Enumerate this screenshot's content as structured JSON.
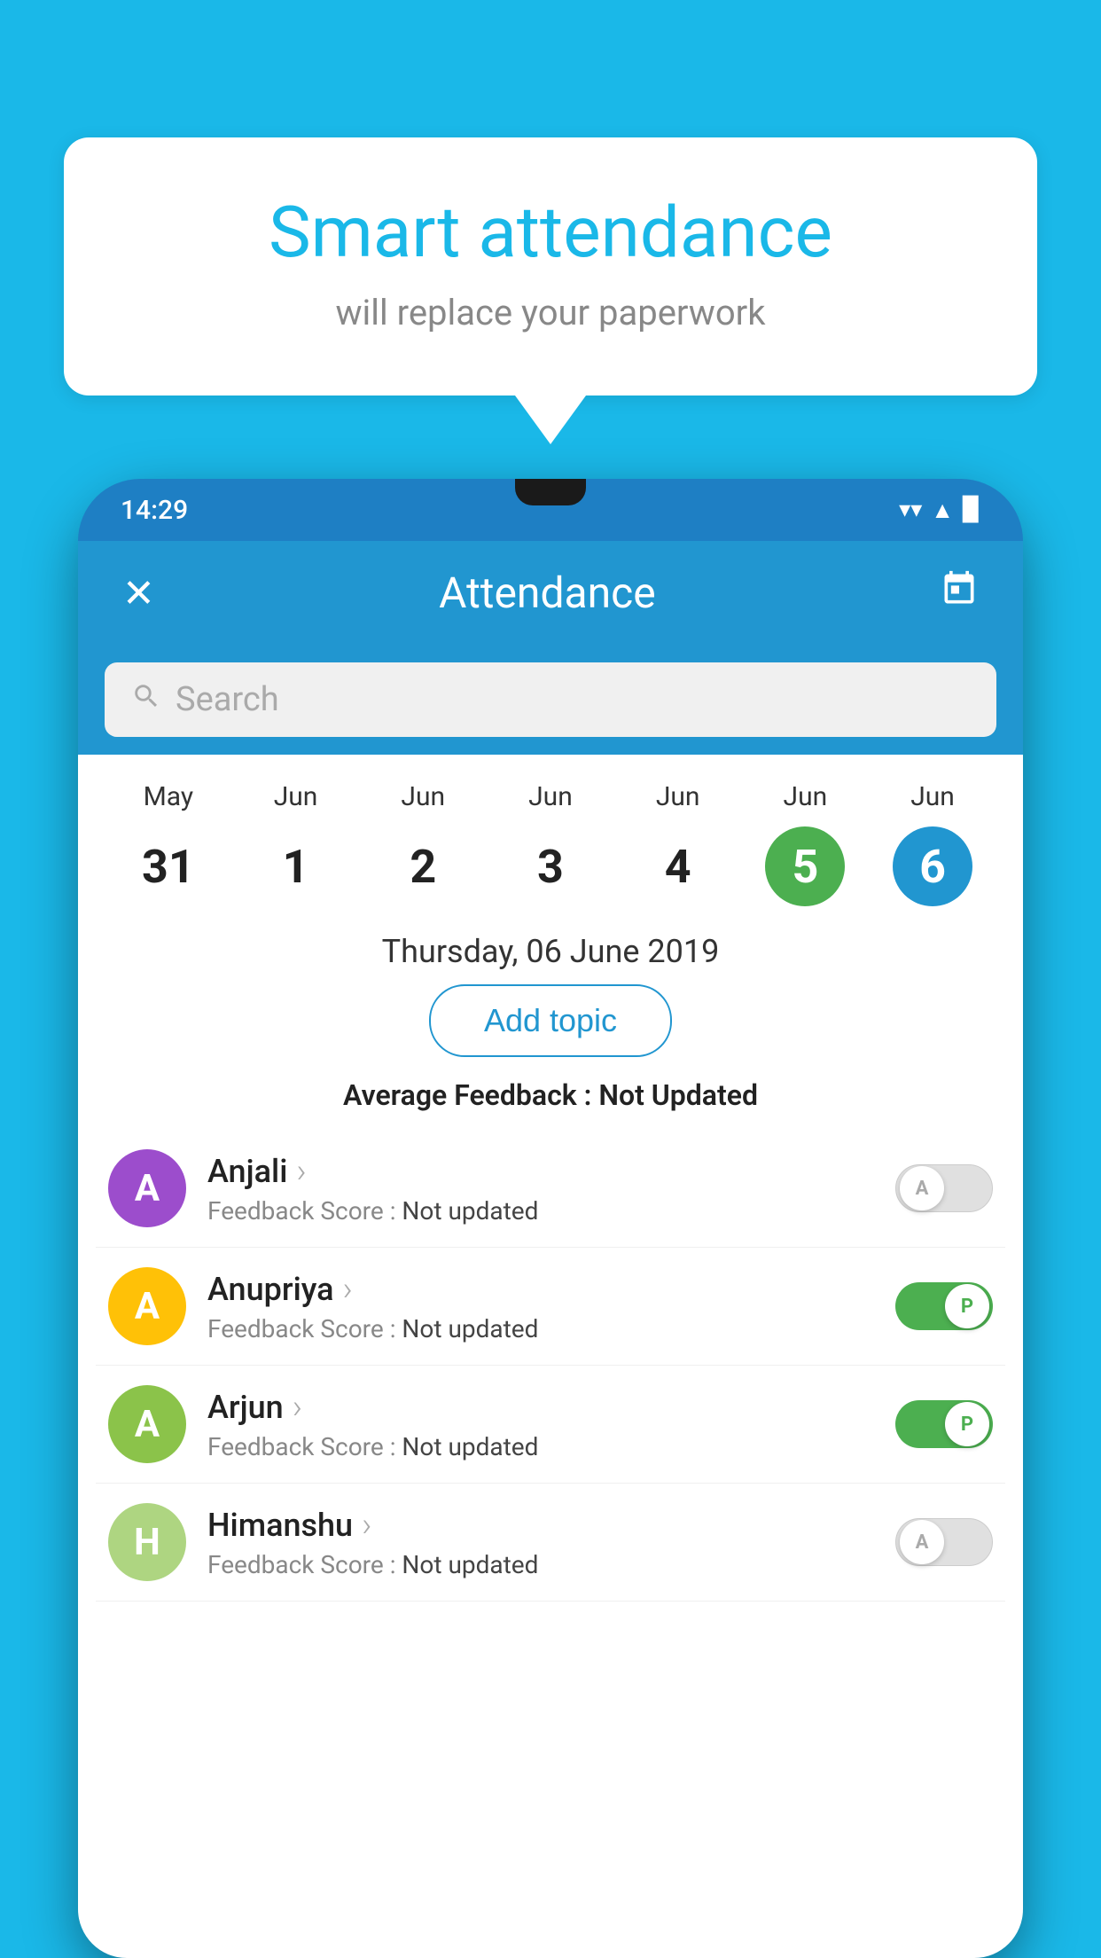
{
  "background_color": "#1ab8e8",
  "speech_bubble": {
    "title": "Smart attendance",
    "subtitle": "will replace your paperwork"
  },
  "status_bar": {
    "time": "14:29",
    "wifi": "▼",
    "signal": "▲",
    "battery": "▉"
  },
  "app_header": {
    "title": "Attendance",
    "close_label": "✕",
    "calendar_icon": "📅"
  },
  "search": {
    "placeholder": "Search"
  },
  "calendar": {
    "days": [
      {
        "month": "May",
        "date": "31",
        "state": "normal"
      },
      {
        "month": "Jun",
        "date": "1",
        "state": "normal"
      },
      {
        "month": "Jun",
        "date": "2",
        "state": "normal"
      },
      {
        "month": "Jun",
        "date": "3",
        "state": "normal"
      },
      {
        "month": "Jun",
        "date": "4",
        "state": "normal"
      },
      {
        "month": "Jun",
        "date": "5",
        "state": "today"
      },
      {
        "month": "Jun",
        "date": "6",
        "state": "selected"
      }
    ]
  },
  "selected_date_label": "Thursday, 06 June 2019",
  "add_topic_label": "Add topic",
  "avg_feedback_label": "Average Feedback : ",
  "avg_feedback_value": "Not Updated",
  "students": [
    {
      "name": "Anjali",
      "avatar_letter": "A",
      "avatar_color": "#9c4dcc",
      "feedback_label": "Feedback Score : ",
      "feedback_value": "Not updated",
      "toggle": "off",
      "toggle_label": "A"
    },
    {
      "name": "Anupriya",
      "avatar_letter": "A",
      "avatar_color": "#ffc107",
      "feedback_label": "Feedback Score : ",
      "feedback_value": "Not updated",
      "toggle": "on",
      "toggle_label": "P"
    },
    {
      "name": "Arjun",
      "avatar_letter": "A",
      "avatar_color": "#8bc34a",
      "feedback_label": "Feedback Score : ",
      "feedback_value": "Not updated",
      "toggle": "on",
      "toggle_label": "P"
    },
    {
      "name": "Himanshu",
      "avatar_letter": "H",
      "avatar_color": "#aed581",
      "feedback_label": "Feedback Score : ",
      "feedback_value": "Not updated",
      "toggle": "off",
      "toggle_label": "A"
    }
  ]
}
